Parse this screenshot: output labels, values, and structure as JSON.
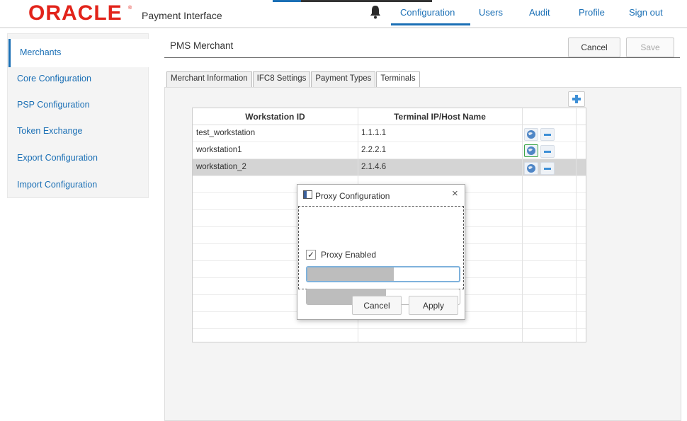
{
  "header": {
    "logo_text": "ORACLE",
    "logo_mark": "®",
    "app_title": "Payment Interface",
    "notification_icon": "bell-icon",
    "nav": [
      {
        "label": "Configuration",
        "active": true
      },
      {
        "label": "Users"
      },
      {
        "label": "Audit"
      },
      {
        "label": "Profile"
      },
      {
        "label": "Sign out"
      }
    ],
    "accent_color": "#1a6fb5",
    "brand_color": "#e2231a"
  },
  "sidebar": {
    "items": [
      {
        "label": "Merchants",
        "active": true
      },
      {
        "label": "Core Configuration"
      },
      {
        "label": "PSP Configuration"
      },
      {
        "label": "Token Exchange"
      },
      {
        "label": "Export Configuration"
      },
      {
        "label": "Import Configuration"
      }
    ]
  },
  "main": {
    "title": "PMS Merchant",
    "cancel_label": "Cancel",
    "save_label": "Save",
    "tabs": [
      {
        "label": "Merchant Information"
      },
      {
        "label": "IFC8 Settings"
      },
      {
        "label": "Payment Types"
      },
      {
        "label": "Terminals",
        "active": true
      }
    ],
    "add_icon": "plus-icon",
    "table": {
      "headers": [
        "Workstation ID",
        "Terminal IP/Host Name"
      ],
      "rows": [
        {
          "workstation": "test_workstation",
          "terminal": "1.1.1.1"
        },
        {
          "workstation": "workstation1",
          "terminal": "2.2.2.1"
        },
        {
          "workstation": "workstation_2",
          "terminal": "2.1.4.6",
          "selected": true
        }
      ],
      "row_icons": [
        "globe-icon",
        "remove-icon"
      ]
    }
  },
  "dialog": {
    "title": "Proxy Configuration",
    "close_glyph": "×",
    "checkbox_label": "Proxy Enabled",
    "checkbox_checked": true,
    "checkbox_glyph": "✓",
    "cancel_label": "Cancel",
    "apply_label": "Apply"
  }
}
